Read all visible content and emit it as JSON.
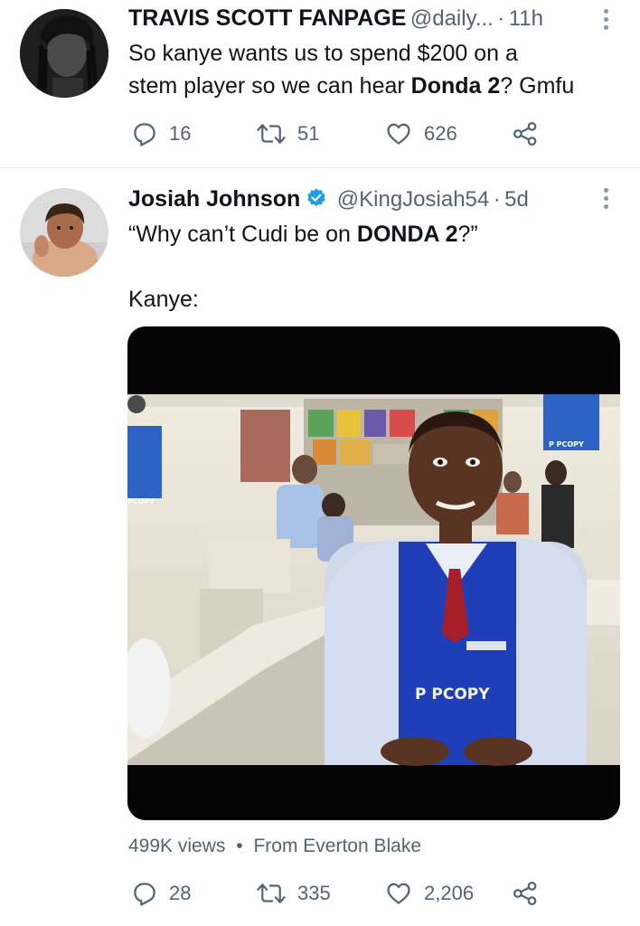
{
  "tweets": [
    {
      "author_name": "TRAVIS SCOTT FANPAGE",
      "handle": "@daily...",
      "dot": "·",
      "time": "11h",
      "text_line1": "So kanye wants us to spend $200 on a",
      "text_line2_pre": "stem player so we can hear ",
      "text_line2_bold": "Donda 2",
      "text_line2_post": "?  Gmfu",
      "replies": "16",
      "retweets": "51",
      "likes": "626"
    },
    {
      "author_name": "Josiah Johnson",
      "handle": "@KingJosiah54",
      "dot": "·",
      "time": "5d",
      "text_line1_pre": "“Why can’t Cudi be on ",
      "text_line1_bold": "DONDA 2",
      "text_line1_post": "?”",
      "text_line2": "Kanye:",
      "media": {
        "apron_text": "P PCOPY",
        "sign_text": "P PCOPY",
        "sign_text_left": "PCOPY"
      },
      "views": "499K views",
      "bullet": "•",
      "from": "From Everton Blake",
      "replies": "28",
      "retweets": "335",
      "likes": "2,206"
    }
  ],
  "colors": {
    "text": "#0f1419",
    "secondary": "#536471",
    "verified": "#1d9bf0",
    "divider": "#e6ecf0"
  }
}
